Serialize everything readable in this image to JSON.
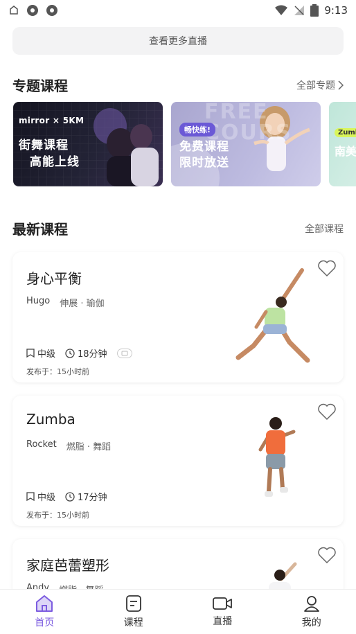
{
  "status_bar": {
    "time": "9:13"
  },
  "more_live_button": "查看更多直播",
  "special_section": {
    "title": "专题课程",
    "link": "全部专题"
  },
  "banners": [
    {
      "brand": "mirror × 5KM",
      "line1": "街舞课程",
      "line2": "高能上线"
    },
    {
      "tag": "畅快练!",
      "line1": "免费课程",
      "line2": "限时放送",
      "bg_text": "FREE\nCOURS"
    },
    {
      "tag": "Zumb",
      "line1": "南美"
    }
  ],
  "latest_section": {
    "title": "最新课程",
    "link": "全部课程"
  },
  "courses": [
    {
      "title": "身心平衡",
      "coach": "Hugo",
      "category": "伸展 · 瑜伽",
      "level": "中级",
      "duration": "18分钟",
      "published": "发布于：15小时前"
    },
    {
      "title": "Zumba",
      "coach": "Rocket",
      "category": "燃脂 · 舞蹈",
      "level": "中级",
      "duration": "17分钟",
      "published": "发布于：15小时前"
    },
    {
      "title": "家庭芭蕾塑形",
      "coach": "Andy",
      "category": "燃脂 · 舞蹈"
    }
  ],
  "tabs": [
    {
      "label": "首页",
      "icon": "home-icon",
      "active": true
    },
    {
      "label": "课程",
      "icon": "course-icon",
      "active": false
    },
    {
      "label": "直播",
      "icon": "camera-icon",
      "active": false
    },
    {
      "label": "我的",
      "icon": "profile-icon",
      "active": false
    }
  ],
  "colors": {
    "accent": "#7c5ce0",
    "banner2_tag": "#6b59d6"
  }
}
